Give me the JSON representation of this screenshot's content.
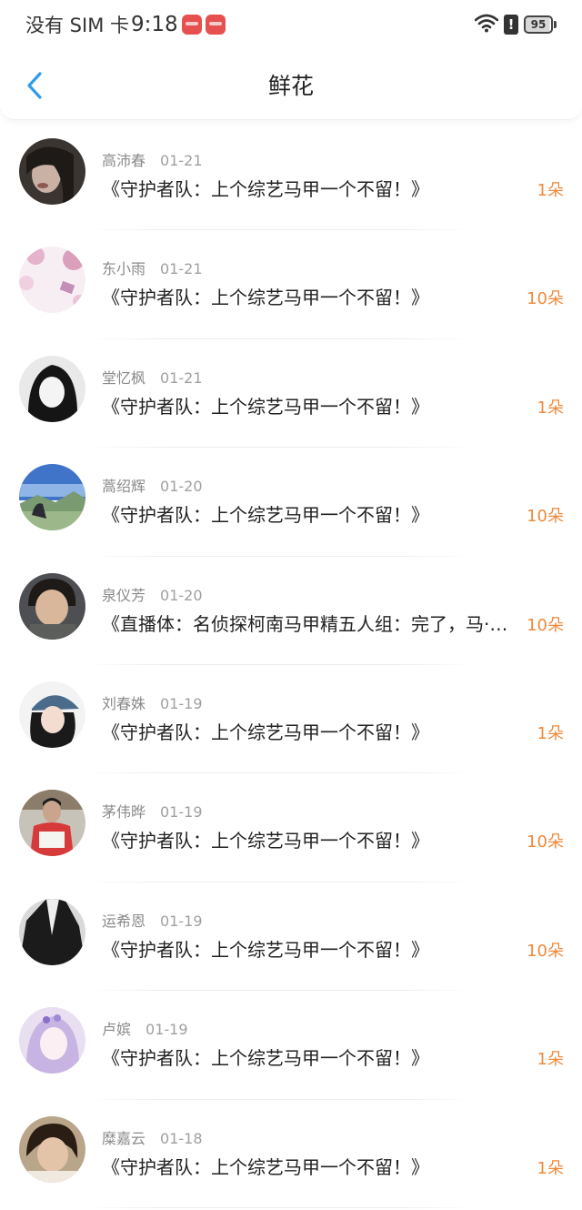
{
  "status_bar": {
    "carrier": "没有 SIM 卡",
    "time": "9:18",
    "battery": "95",
    "alert": "!",
    "icons": [
      "app-badge-icon",
      "app-badge-icon",
      "wifi-icon",
      "alert-icon",
      "battery-icon"
    ]
  },
  "header": {
    "title": "鲜花",
    "back_icon": "chevron-left-icon",
    "accent_color": "#2f9bea"
  },
  "colors": {
    "count": "#ed8a3c",
    "name": "#8a8a8a",
    "title": "#222222"
  },
  "items": [
    {
      "name": "高沛春",
      "date": "01-21",
      "title": "《守护者队：上个综艺马甲一个不留！》",
      "count": "1朵",
      "avatar": "portrait-dark"
    },
    {
      "name": "东小雨",
      "date": "01-21",
      "title": "《守护者队：上个综艺马甲一个不留！》",
      "count": "10朵",
      "avatar": "pink-blossom"
    },
    {
      "name": "堂忆枫",
      "date": "01-21",
      "title": "《守护者队：上个综艺马甲一个不留！》",
      "count": "1朵",
      "avatar": "anime-bw"
    },
    {
      "name": "蒿绍辉",
      "date": "01-20",
      "title": "《守护者队：上个综艺马甲一个不留！》",
      "count": "10朵",
      "avatar": "landscape"
    },
    {
      "name": "泉仪芳",
      "date": "01-20",
      "title": "《直播体：名侦探柯南马甲精五人组：完了，马·…",
      "count": "10朵",
      "avatar": "boy-face"
    },
    {
      "name": "刘春姝",
      "date": "01-19",
      "title": "《守护者队：上个综艺马甲一个不留！》",
      "count": "1朵",
      "avatar": "girl-cap"
    },
    {
      "name": "茅伟晔",
      "date": "01-19",
      "title": "《守护者队：上个综艺马甲一个不留！》",
      "count": "10朵",
      "avatar": "student-red"
    },
    {
      "name": "运希恩",
      "date": "01-19",
      "title": "《守护者队：上个综艺马甲一个不留！》",
      "count": "10朵",
      "avatar": "black-coat"
    },
    {
      "name": "卢嫔",
      "date": "01-19",
      "title": "《守护者队：上个综艺马甲一个不留！》",
      "count": "1朵",
      "avatar": "anime-purple"
    },
    {
      "name": "糜嘉云",
      "date": "01-18",
      "title": "《守护者队：上个综艺马甲一个不留！》",
      "count": "1朵",
      "avatar": "portrait-hair"
    }
  ]
}
